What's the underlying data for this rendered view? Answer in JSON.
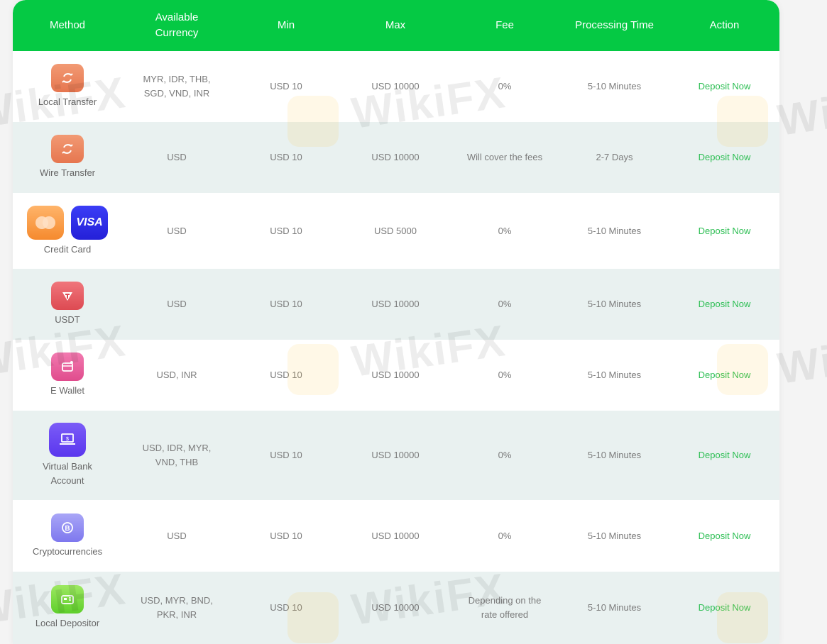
{
  "headers": [
    "Method",
    "Available Currency",
    "Min",
    "Max",
    "Fee",
    "Processing Time",
    "Action"
  ],
  "watermark": "WikiFX",
  "rows": [
    {
      "method": "Local Transfer",
      "icon": "transfer-icon",
      "currency": "MYR, IDR, THB, SGD, VND, INR",
      "min": "USD 10",
      "max": "USD 10000",
      "fee": "0%",
      "time": "5-10 Minutes",
      "action": "Deposit Now"
    },
    {
      "method": "Wire Transfer",
      "icon": "transfer-icon",
      "currency": "USD",
      "min": "USD 10",
      "max": "USD 10000",
      "fee": "Will cover the fees",
      "time": "2-7 Days",
      "action": "Deposit Now"
    },
    {
      "method": "Credit Card",
      "icon": "mastercard-icon",
      "icon2": "visa-icon",
      "icon2_text": "VISA",
      "currency": "USD",
      "min": "USD 10",
      "max": "USD 5000",
      "fee": "0%",
      "time": "5-10 Minutes",
      "action": "Deposit Now"
    },
    {
      "method": "USDT",
      "icon": "tether-icon",
      "currency": "USD",
      "min": "USD 10",
      "max": "USD 10000",
      "fee": "0%",
      "time": "5-10 Minutes",
      "action": "Deposit Now"
    },
    {
      "method": "E Wallet",
      "icon": "wallet-icon",
      "currency": "USD, INR",
      "min": "USD 10",
      "max": "USD 10000",
      "fee": "0%",
      "time": "5-10 Minutes",
      "action": "Deposit Now"
    },
    {
      "method": "Virtual Bank Account",
      "icon": "laptop-bank-icon",
      "currency": "USD, IDR, MYR, VND, THB",
      "min": "USD 10",
      "max": "USD 10000",
      "fee": "0%",
      "time": "5-10 Minutes",
      "action": "Deposit Now"
    },
    {
      "method": "Cryptocurrencies",
      "icon": "bitcoin-icon",
      "currency": "USD",
      "min": "USD 10",
      "max": "USD 10000",
      "fee": "0%",
      "time": "5-10 Minutes",
      "action": "Deposit Now"
    },
    {
      "method": "Local Depositor",
      "icon": "depositor-icon",
      "currency": "USD, MYR, BND, PKR, INR",
      "min": "USD 10",
      "max": "USD 10000",
      "fee": "Depending on the rate offered",
      "time": "5-10 Minutes",
      "action": "Deposit Now"
    }
  ],
  "colors": {
    "header_bg": "#05c944",
    "action_text": "#2fbf55",
    "alt_row": "#e9f1f0"
  }
}
